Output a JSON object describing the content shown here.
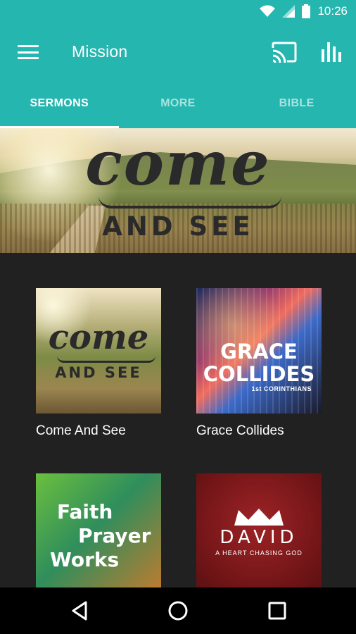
{
  "status_bar": {
    "time": "10:26",
    "icons": [
      "wifi-icon",
      "signal-icon",
      "battery-icon"
    ]
  },
  "app_bar": {
    "title": "Mission",
    "icons": [
      "menu-icon",
      "cast-icon",
      "stats-icon"
    ]
  },
  "tabs": [
    {
      "label": "SERMONS",
      "active": true
    },
    {
      "label": "MORE",
      "active": false
    },
    {
      "label": "BIBLE",
      "active": false
    }
  ],
  "banner": {
    "line1": "come",
    "line2": "AND SEE"
  },
  "series": [
    {
      "title": "Come And See",
      "art_line1": "come",
      "art_line2": "AND SEE"
    },
    {
      "title": "Grace Collides",
      "art_line1": "GRACE",
      "art_line2": "COLLIDES",
      "art_subtitle": "1st CORINTHIANS"
    },
    {
      "title": "",
      "art_line1": "Faith",
      "art_line2": "Prayer",
      "art_line3": "Works"
    },
    {
      "title": "",
      "art_line1": "DAVID",
      "art_subtitle": "A HEART CHASING GOD"
    }
  ],
  "colors": {
    "primary": "#26b6b0",
    "background": "#212121",
    "nav_bar": "#000000"
  },
  "nav_bar": {
    "icons": [
      "back-icon",
      "home-icon",
      "recents-icon"
    ]
  }
}
